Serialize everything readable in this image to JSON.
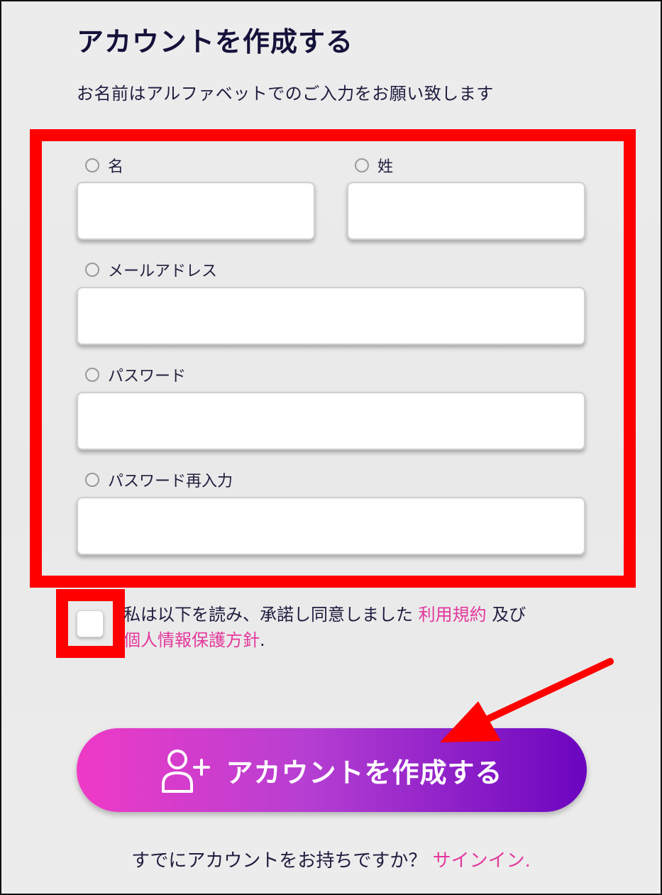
{
  "header": {
    "title": "アカウントを作成する",
    "subtitle": "お名前はアルファベットでのご入力をお願い致します"
  },
  "form": {
    "first_name_label": "名",
    "last_name_label": "姓",
    "email_label": "メールアドレス",
    "password_label": "パスワード",
    "password_confirm_label": "パスワード再入力",
    "first_name_value": "",
    "last_name_value": "",
    "email_value": "",
    "password_value": "",
    "password_confirm_value": ""
  },
  "consent": {
    "text_before": "私は以下を読み、承諾し同意しました",
    "terms_link": "利用規約",
    "and_text": "及び",
    "privacy_link": "個人情報保護方針",
    "period": "."
  },
  "cta": {
    "label": "アカウントを作成する",
    "icon": "add-user-icon"
  },
  "footer": {
    "question": "すでにアカウントをお持ちですか？",
    "signin_link": "サインイン."
  },
  "colors": {
    "highlight": "#ff0000",
    "link": "#e4389c",
    "cta_start": "#ee3ac6",
    "cta_end": "#6b05bf",
    "text": "#1c1a3a"
  }
}
